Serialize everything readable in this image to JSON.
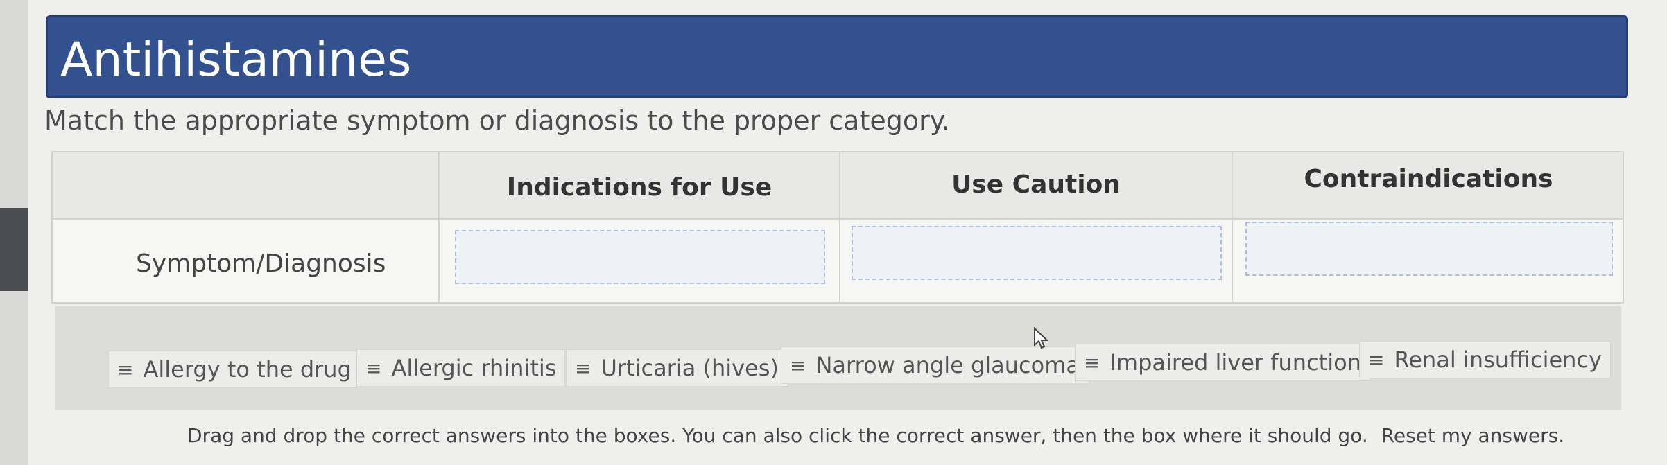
{
  "title": "Antihistamines",
  "instructions": "Match the appropriate symptom or diagnosis to the proper category.",
  "table": {
    "columns": [
      "Indications for Use",
      "Use Caution",
      "Contraindications"
    ],
    "row_label": "Symptom/Diagnosis"
  },
  "answers": [
    {
      "icon": "drag-handle-icon",
      "label": "Allergy to the drug"
    },
    {
      "icon": "drag-handle-icon",
      "label": "Allergic rhinitis"
    },
    {
      "icon": "drag-handle-icon",
      "label": "Urticaria (hives)"
    },
    {
      "icon": "drag-handle-icon",
      "label": "Narrow angle glaucoma"
    },
    {
      "icon": "drag-handle-icon",
      "label": "Impaired liver function"
    },
    {
      "icon": "drag-handle-icon",
      "label": "Renal insufficiency"
    }
  ],
  "footer": {
    "text": "Drag and drop the correct answers into the boxes. You can also click the correct answer, then the box where it should go.",
    "reset_link": "Reset my answers."
  },
  "colors": {
    "title_bar": "#33508f",
    "drop_border": "#aebfd9"
  }
}
